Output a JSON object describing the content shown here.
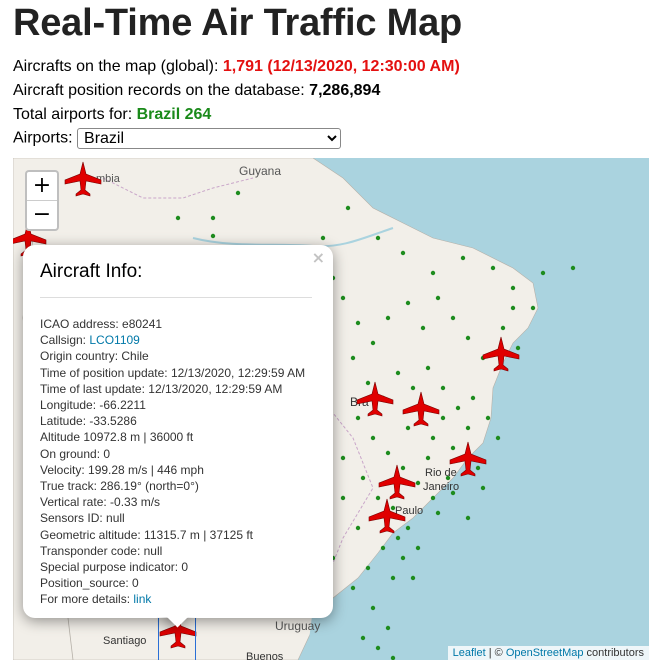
{
  "page": {
    "title": "Real-Time Air Traffic Map",
    "aircrafts_label": "Aircrafts on the map (global):",
    "aircrafts_value": "1,791 (12/13/2020, 12:30:00 AM)",
    "records_label": "Aircraft position records on the database:",
    "records_value": "7,286,894",
    "airports_total_label": "Total airports for:",
    "airports_total_value": "Brazil 264",
    "airports_select_label": "Airports:",
    "airports_selected": "Brazil"
  },
  "map": {
    "zoom_in": "+",
    "zoom_out": "−",
    "place_labels": [
      "Guyana",
      "mbia",
      "Bra",
      "Rio de",
      "Janeiro",
      "Paulo",
      "Uruguay",
      "Santiago",
      "Buenos"
    ],
    "attribution": {
      "leaflet": "Leaflet",
      "separator": " | © ",
      "osm": "OpenStreetMap",
      "suffix": " contributors"
    },
    "colors": {
      "ocean": "#aad3df",
      "land": "#f2efe9",
      "airport_dot": "#1e8c1e",
      "aircraft": "#e00000"
    }
  },
  "popup": {
    "title": "Aircraft Info:",
    "close": "×",
    "fields": [
      "ICAO address: e80241",
      "Callsign: ",
      "Origin country: Chile",
      "Time of position update: 12/13/2020, 12:29:59 AM",
      "Time of last update: 12/13/2020, 12:29:59 AM",
      "Longitude: -66.2211",
      "Latitude: -33.5286",
      "Altitude 10972.8 m | 36000 ft",
      "On ground: 0",
      "Velocity: 199.28 m/s | 446 mph",
      "True track: 286.19° (north=0°)",
      "Vertical rate: -0.33 m/s",
      "Sensors ID: null",
      "Geometric altitude: 11315.7 m | 37125 ft",
      "Transponder code: null",
      "Special purpose indicator: 0",
      "Position_source: 0",
      "For more details: "
    ],
    "callsign_link": "LCO1109",
    "details_link": "link"
  }
}
